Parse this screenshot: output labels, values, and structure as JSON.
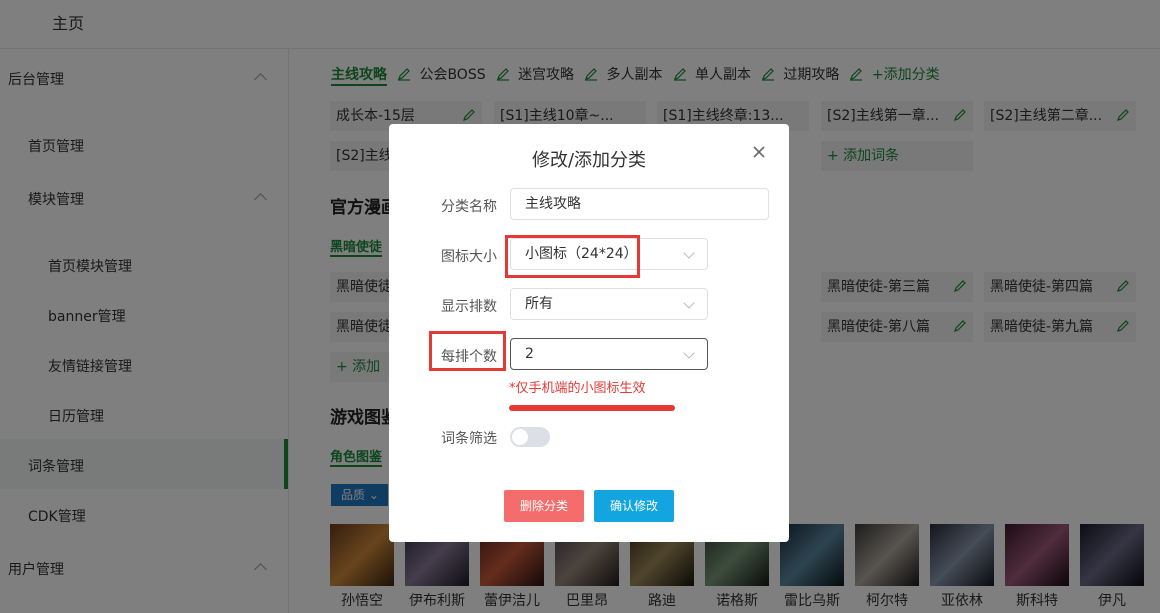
{
  "header": {
    "home": "主页"
  },
  "sidebar": {
    "items": [
      {
        "label": "后台管理"
      },
      {
        "label": "首页管理"
      },
      {
        "label": "模块管理"
      },
      {
        "label": "首页模块管理"
      },
      {
        "label": "banner管理"
      },
      {
        "label": "友情链接管理"
      },
      {
        "label": "日历管理"
      },
      {
        "label": "词条管理"
      },
      {
        "label": "CDK管理"
      },
      {
        "label": "用户管理"
      }
    ]
  },
  "tabs": [
    "主线攻略",
    "公会BOSS",
    "迷宫攻略",
    "多人副本",
    "单人副本",
    "过期攻略"
  ],
  "add_category": "+添加分类",
  "entries_row1": [
    "成长本-15层",
    "[S1]主线10章~...",
    "[S1]主线终章:13...",
    "[S2]主线第一章...",
    "[S2]主线第二章..."
  ],
  "entries_row2_first": "[S2]主线",
  "add_entry": "+ 添加词条",
  "section1_title": "官方漫画",
  "section1_subtab": "黑暗使徒",
  "dark_entries": [
    "黑暗使徒",
    "黑暗使徒",
    "黑暗使徒-第三篇",
    "黑暗使徒-第四篇",
    "黑暗使徒-第八篇",
    "黑暗使徒-第九篇"
  ],
  "add_partial": "+ 添加",
  "section2_title": "游戏图鉴",
  "section2_subtab": "角色图鉴",
  "filter_label": "品质",
  "characters": [
    "孙悟空",
    "伊布利斯",
    "蕾伊洁儿",
    "巴里昂",
    "路迪",
    "诺格斯",
    "雷比乌斯",
    "柯尔特",
    "亚依林",
    "斯科特",
    "伊凡"
  ],
  "dialog": {
    "title": "修改/添加分类",
    "name_label": "分类名称",
    "name_value": "主线攻略",
    "icon_size_label": "图标大小",
    "icon_size_value": "小图标（24*24）",
    "rows_label": "显示排数",
    "rows_value": "所有",
    "per_row_label": "每排个数",
    "per_row_value": "2",
    "hint": "*仅手机端的小图标生效",
    "filter_label": "词条筛选",
    "filter_enabled": false,
    "delete_button": "删除分类",
    "confirm_button": "确认修改"
  },
  "colors": {
    "accent": "#1a8a3a",
    "danger": "#f56c6c",
    "primary": "#12a5e0",
    "highlight": "#e53935"
  }
}
